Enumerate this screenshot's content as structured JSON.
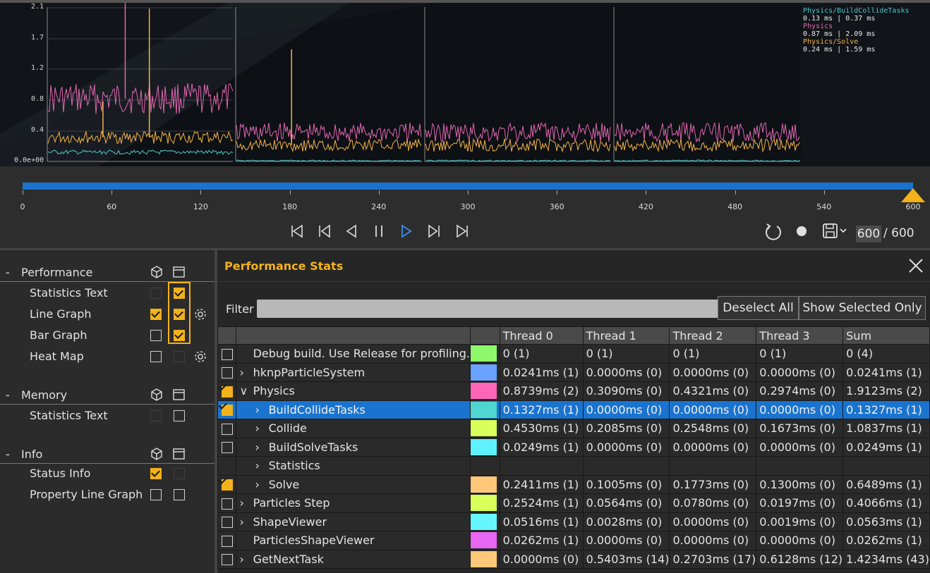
{
  "graph": {
    "y_labels": [
      "2.1",
      "1.7",
      "1.2",
      "0.8",
      "0.4",
      "0.0e+00"
    ],
    "legend": [
      {
        "name": "Physics/BuildCollideTasks",
        "value": "0.13 ms | 0.37 ms",
        "color": "#4fc7c7"
      },
      {
        "name": "Physics",
        "value": "0.87 ms | 2.09 ms",
        "color": "#e066b0"
      },
      {
        "name": "Physics/Solve",
        "value": "0.24 ms | 1.59 ms",
        "color": "#f2b24a"
      }
    ]
  },
  "timeline": {
    "ticks": [
      "0",
      "60",
      "120",
      "180",
      "240",
      "300",
      "360",
      "420",
      "480",
      "540",
      "600"
    ],
    "progress": 1.0,
    "frame_current": "600",
    "frame_total": "/ 600"
  },
  "left_panel": {
    "sections": [
      {
        "title": "Performance",
        "dash": "-",
        "items": [
          {
            "label": "Statistics Text",
            "a": "dim",
            "b": "on"
          },
          {
            "label": "Line Graph",
            "a": "on",
            "b": "on",
            "gear": true
          },
          {
            "label": "Bar Graph",
            "a": "off",
            "b": "on"
          },
          {
            "label": "Heat Map",
            "a": "off",
            "b": "dim",
            "gear": true
          }
        ]
      },
      {
        "title": "Memory",
        "dash": "-",
        "items": [
          {
            "label": "Statistics Text",
            "a": "dim",
            "b": "off"
          }
        ]
      },
      {
        "title": "Info",
        "dash": "-",
        "items": [
          {
            "label": "Status Info",
            "a": "on",
            "b": "dim"
          },
          {
            "label": "Property Line Graph",
            "a": "off",
            "b": "off"
          }
        ]
      }
    ]
  },
  "stats": {
    "title": "Performance Stats",
    "filter_label": "Filter",
    "filter_value": "",
    "deselect_all": "Deselect All",
    "show_selected_only": "Show Selected Only",
    "columns": [
      "Thread 0",
      "Thread 1",
      "Thread 2",
      "Thread 3",
      "Sum"
    ],
    "rows": [
      {
        "checked": "off",
        "chev": "",
        "indent": 0,
        "name": "Debug build. Use Release for profiling.",
        "color": "#8ef76a",
        "values": [
          "0 (1)",
          "0 (1)",
          "0 (1)",
          "0 (1)",
          "0 (4)"
        ]
      },
      {
        "checked": "off",
        "chev": ">",
        "indent": 0,
        "name": "hknpParticleSystem",
        "color": "#6aa2ff",
        "values": [
          "0.0241ms (1)",
          "0.0000ms (0)",
          "0.0000ms (0)",
          "0.0000ms (0)",
          "0.0241ms (1)"
        ]
      },
      {
        "checked": "on",
        "chev": "v",
        "indent": 0,
        "name": "Physics",
        "color": "#ff66b8",
        "values": [
          "0.8739ms (2)",
          "0.3090ms (0)",
          "0.4321ms (0)",
          "0.2974ms (0)",
          "1.9123ms (2)"
        ]
      },
      {
        "checked": "on",
        "chev": ">",
        "indent": 1,
        "name": "BuildCollideTasks",
        "color": "#4fd6d0",
        "values": [
          "0.1327ms (1)",
          "0.0000ms (0)",
          "0.0000ms (0)",
          "0.0000ms (0)",
          "0.1327ms (1)"
        ],
        "selected": true
      },
      {
        "checked": "off",
        "chev": ">",
        "indent": 1,
        "name": "Collide",
        "color": "#d8ff5a",
        "values": [
          "0.4530ms (1)",
          "0.2085ms (0)",
          "0.2548ms (0)",
          "0.1673ms (0)",
          "1.0837ms (1)"
        ]
      },
      {
        "checked": "off",
        "chev": ">",
        "indent": 1,
        "name": "BuildSolveTasks",
        "color": "#5ef2ff",
        "values": [
          "0.0249ms (1)",
          "0.0000ms (0)",
          "0.0000ms (0)",
          "0.0000ms (0)",
          "0.0249ms (1)"
        ]
      },
      {
        "checked": "none",
        "chev": ">",
        "indent": 1,
        "name": "Statistics",
        "color": "",
        "values": [
          "",
          "",
          "",
          "",
          ""
        ]
      },
      {
        "checked": "on",
        "chev": ">",
        "indent": 1,
        "name": "Solve",
        "color": "#ffc878",
        "values": [
          "0.2411ms (1)",
          "0.1005ms (0)",
          "0.1773ms (0)",
          "0.1300ms (0)",
          "0.6489ms (1)"
        ]
      },
      {
        "checked": "off",
        "chev": ">",
        "indent": 0,
        "name": "Particles Step",
        "color": "#d8ff5a",
        "values": [
          "0.2524ms (1)",
          "0.0564ms (0)",
          "0.0780ms (0)",
          "0.0197ms (0)",
          "0.4066ms (1)"
        ]
      },
      {
        "checked": "off",
        "chev": ">",
        "indent": 0,
        "name": "ShapeViewer",
        "color": "#66f6ff",
        "values": [
          "0.0516ms (1)",
          "0.0028ms (0)",
          "0.0000ms (0)",
          "0.0019ms (0)",
          "0.0563ms (1)"
        ]
      },
      {
        "checked": "off",
        "chev": "",
        "indent": 0,
        "name": "ParticlesShapeViewer",
        "color": "#e766f2",
        "values": [
          "0.0262ms (1)",
          "0.0000ms (0)",
          "0.0000ms (0)",
          "0.0000ms (0)",
          "0.0262ms (1)"
        ]
      },
      {
        "checked": "off",
        "chev": ">",
        "indent": 0,
        "name": "GetNextTask",
        "color": "#ffc878",
        "values": [
          "0.0000ms (0)",
          "0.5403ms (14)",
          "0.2703ms (17)",
          "0.6128ms (12)",
          "1.4234ms (43)"
        ]
      }
    ]
  },
  "colors": {
    "accent": "#f2b21a",
    "selection": "#1a74cf",
    "timeline": "#1a74cf"
  }
}
